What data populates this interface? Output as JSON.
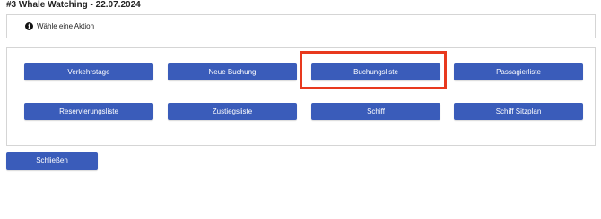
{
  "dialog": {
    "title": "#3 Whale Watching - 22.07.2024",
    "info_text": "Wähle eine Aktion",
    "info_icon": "info-icon",
    "close_label": "Schließen"
  },
  "actions": {
    "row1": [
      "Verkehrstage",
      "Neue Buchung",
      "Buchungsliste",
      "Passagierliste"
    ],
    "row2": [
      "Reservierungsliste",
      "Zustiegsliste",
      "Schiff",
      "Schiff Sitzplan"
    ],
    "highlighted": "Buchungsliste"
  },
  "colors": {
    "button": "#3a5cba",
    "highlight": "#e8391e"
  }
}
